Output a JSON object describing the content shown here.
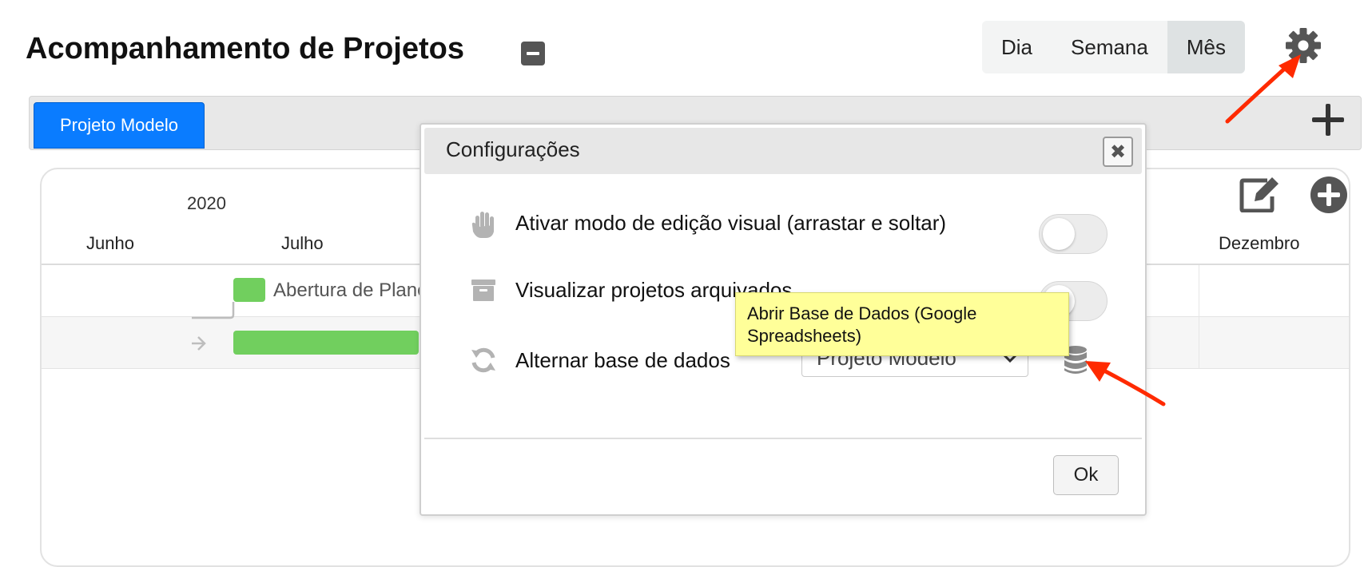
{
  "header": {
    "title": "Acompanhamento de Projetos",
    "views": [
      {
        "label": "Dia"
      },
      {
        "label": "Semana"
      },
      {
        "label": "Mês",
        "active": true
      }
    ],
    "settings_icon": "gear-icon"
  },
  "tabs": {
    "active_label": "Projeto Modelo",
    "add_icon": "plus-icon"
  },
  "gantt": {
    "year": "2020",
    "months": [
      "Junho",
      "Julho",
      "Dezembro"
    ],
    "task_label": "Abertura de Plane",
    "task_color": "#71cf5e"
  },
  "modal": {
    "title": "Configurações",
    "options": [
      {
        "icon": "hand-icon",
        "label": "Ativar modo de edição visual (arrastar e soltar)",
        "enabled": false
      },
      {
        "icon": "archive-icon",
        "label": "Visualizar projetos arquivados",
        "enabled": false
      },
      {
        "icon": "refresh-icon",
        "label": "Alternar base de dados"
      }
    ],
    "database_select_value": "Projeto Modelo",
    "tooltip": "Abrir Base de Dados (Google Spreadsheets)",
    "ok_label": "Ok"
  },
  "colors": {
    "accent": "#0a7cff",
    "annotation_arrow": "#ff2a00",
    "tooltip_bg": "#ffff99"
  }
}
